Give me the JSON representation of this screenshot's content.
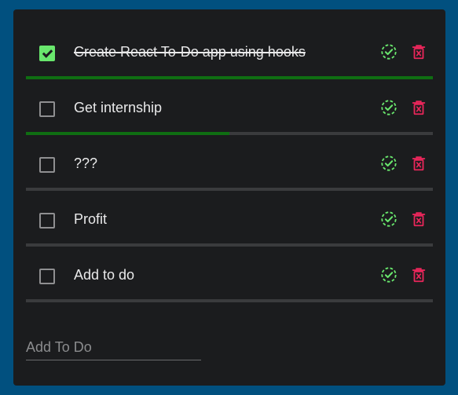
{
  "colors": {
    "background": "#01507f",
    "card": "#1b1c1e",
    "accent_green": "#69e76d",
    "progress_green": "#0f6e12",
    "delete_red": "#e8265a"
  },
  "todos": [
    {
      "label": "Create React To-Do app using hooks",
      "completed": true,
      "progress": 1.0
    },
    {
      "label": "Get internship",
      "completed": false,
      "progress": 0.5
    },
    {
      "label": "???",
      "completed": false,
      "progress": 0
    },
    {
      "label": "Profit",
      "completed": false,
      "progress": 0
    },
    {
      "label": "Add to do",
      "completed": false,
      "progress": 0
    }
  ],
  "icons": {
    "complete": "dashed-circle-check-icon",
    "delete": "trash-icon"
  },
  "add_input": {
    "placeholder": "Add To Do",
    "value": ""
  }
}
